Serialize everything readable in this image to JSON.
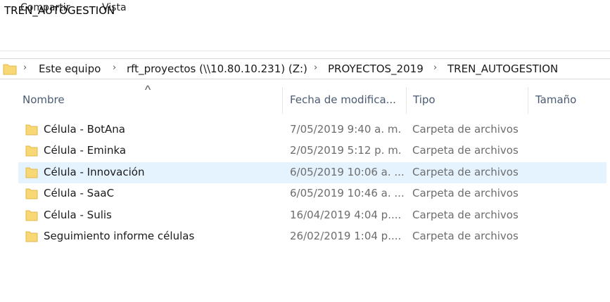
{
  "window": {
    "title": "TREN_AUTOGESTION"
  },
  "ribbon": {
    "tabs": [
      "Compartir",
      "Vista"
    ]
  },
  "address": {
    "crumbs": [
      "Este equipo",
      "rft_proyectos (\\\\10.80.10.231) (Z:)",
      "PROYECTOS_2019",
      "TREN_AUTOGESTION"
    ]
  },
  "columns": {
    "name": "Nombre",
    "date": "Fecha de modifica...",
    "type": "Tipo",
    "size": "Tamaño"
  },
  "files": [
    {
      "name": "Célula - BotAna",
      "date": "7/05/2019 9:40 a. m.",
      "type": "Carpeta de archivos"
    },
    {
      "name": "Célula - Eminka",
      "date": "2/05/2019 5:12 p. m.",
      "type": "Carpeta de archivos"
    },
    {
      "name": "Célula - Innovación",
      "date": "6/05/2019 10:06 a. ...",
      "type": "Carpeta de archivos"
    },
    {
      "name": "Célula - SaaC",
      "date": "6/05/2019 10:46 a. ...",
      "type": "Carpeta de archivos"
    },
    {
      "name": "Célula - Sulis",
      "date": "16/04/2019 4:04 p....",
      "type": "Carpeta de archivos"
    },
    {
      "name": "Seguimiento informe células",
      "date": "26/02/2019 1:04 p....",
      "type": "Carpeta de archivos"
    }
  ],
  "colors": {
    "folder": "#f8d775",
    "folder_dark": "#e2b84a",
    "selected_row": "#e5f3ff",
    "header_text": "#4a5b73"
  }
}
